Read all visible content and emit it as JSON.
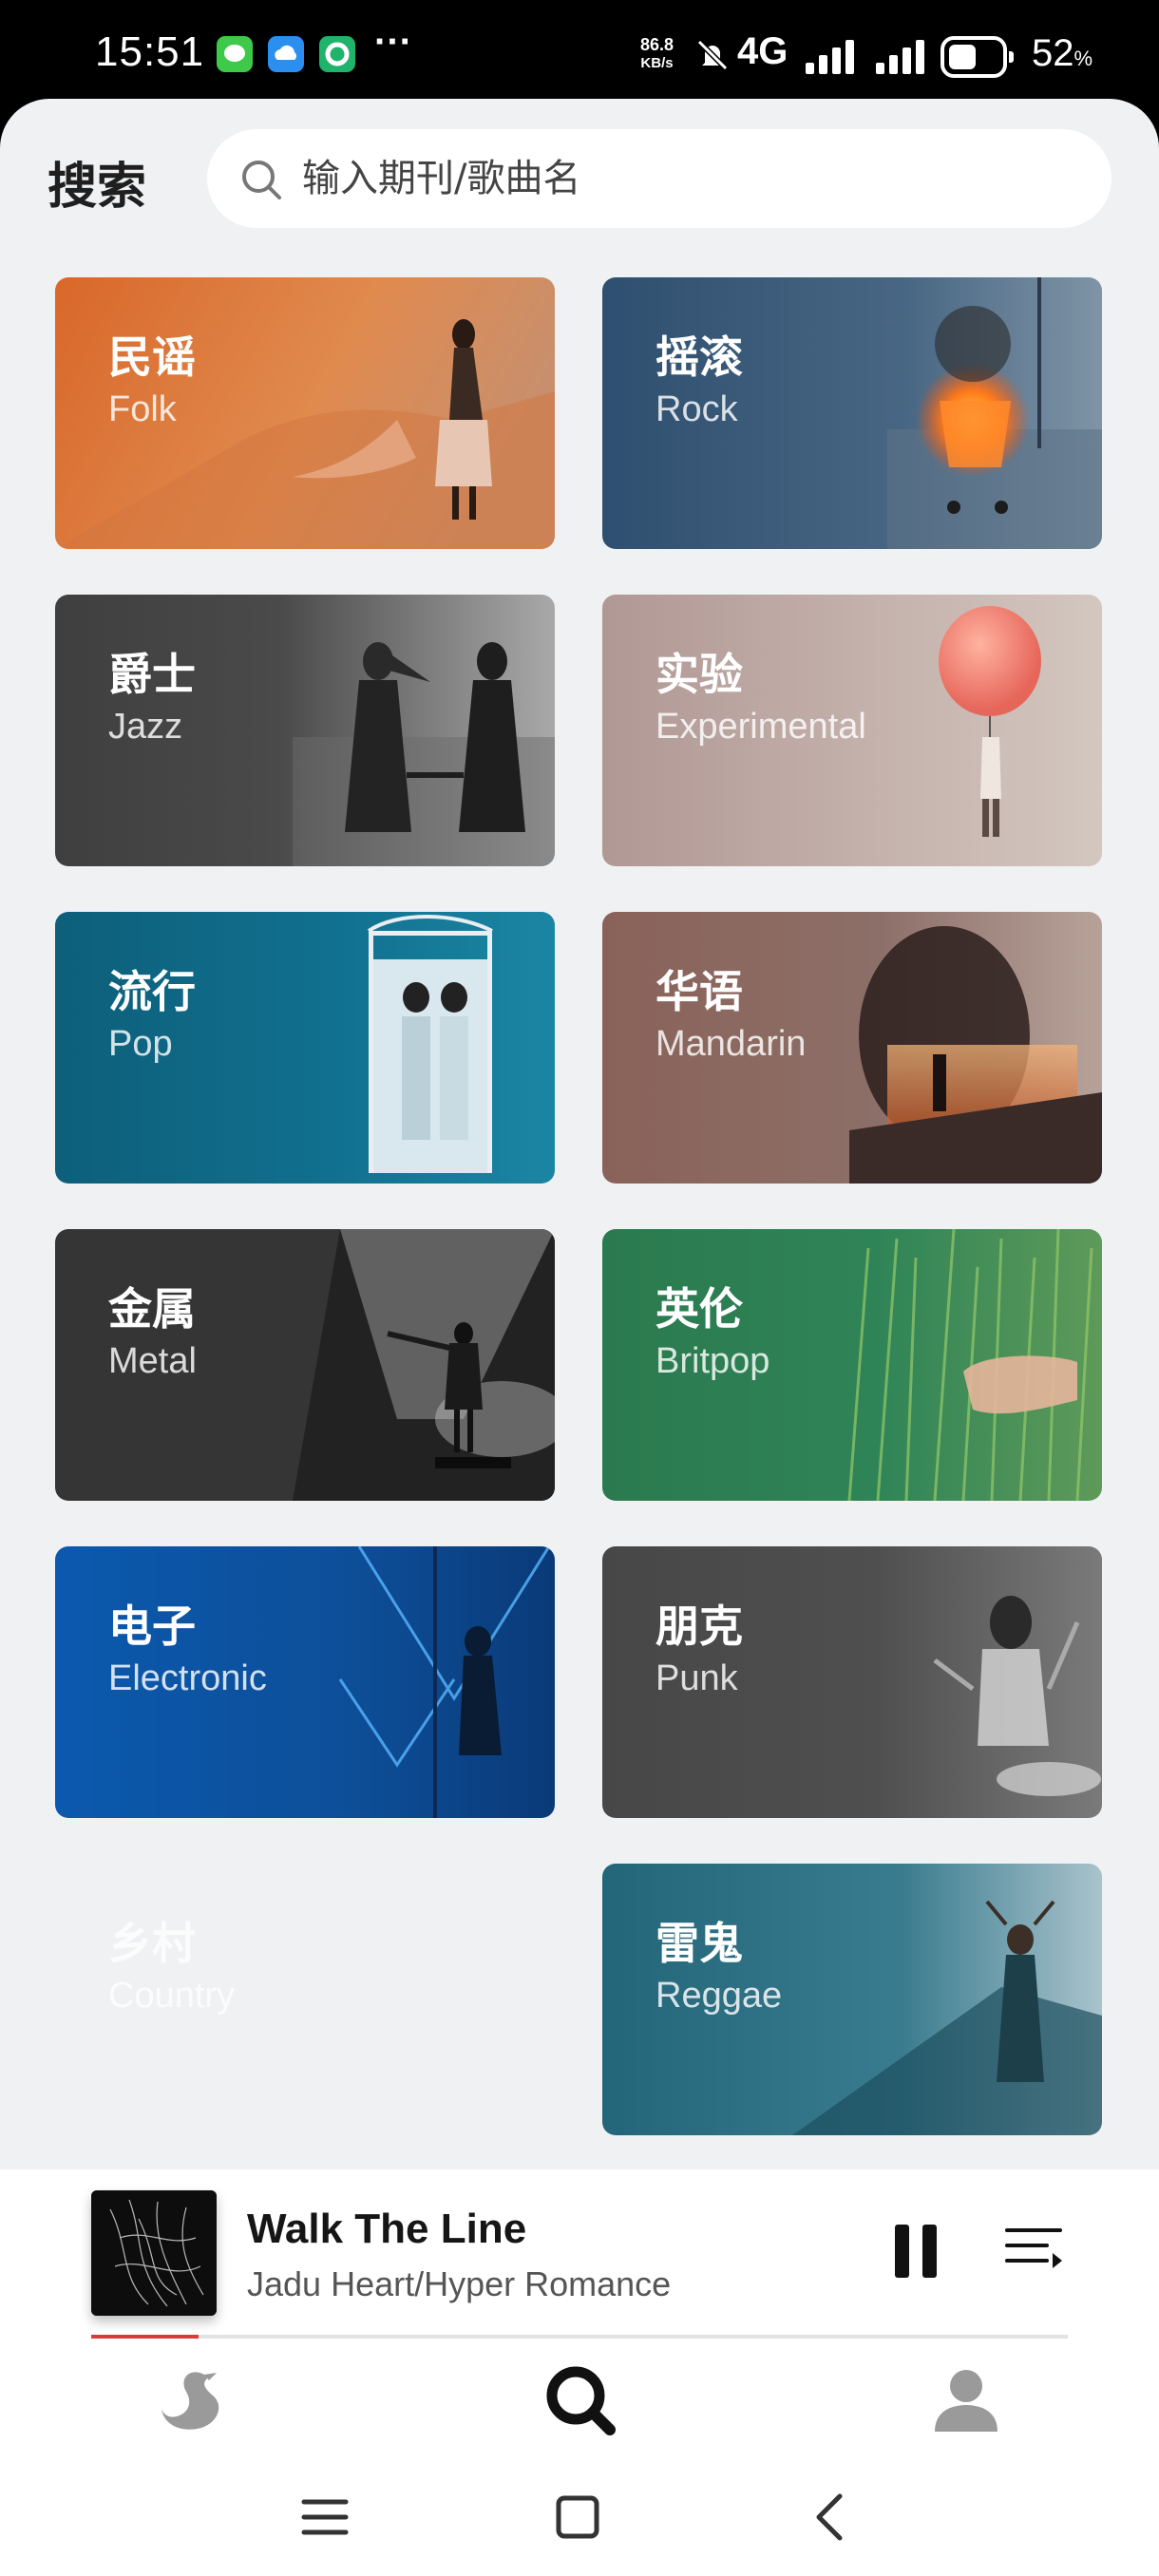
{
  "status_bar": {
    "time": "15:51",
    "more": "···",
    "net_speed_value": "86.8",
    "net_speed_unit": "KB/s",
    "network": "4G",
    "battery_value": "52",
    "battery_unit": "%"
  },
  "search": {
    "label": "搜索",
    "placeholder": "输入期刊/歌曲名"
  },
  "genres": [
    {
      "zh": "民谣",
      "en": "Folk",
      "color": "#d97a3a"
    },
    {
      "zh": "摇滚",
      "en": "Rock",
      "color": "#3a5775"
    },
    {
      "zh": "爵士",
      "en": "Jazz",
      "color": "#4b4b4b"
    },
    {
      "zh": "实验",
      "en": "Experimental",
      "color": "#b8a4a0"
    },
    {
      "zh": "流行",
      "en": "Pop",
      "color": "#116a86"
    },
    {
      "zh": "华语",
      "en": "Mandarin",
      "color": "#8a6a62"
    },
    {
      "zh": "金属",
      "en": "Metal",
      "color": "#3b3b3b"
    },
    {
      "zh": "英伦",
      "en": "Britpop",
      "color": "#2d7f55"
    },
    {
      "zh": "电子",
      "en": "Electronic",
      "color": "#0d5fb0"
    },
    {
      "zh": "朋克",
      "en": "Punk",
      "color": "#4e4e4e"
    },
    {
      "zh": "乡村",
      "en": "Country",
      "color": "#eff1f3"
    },
    {
      "zh": "雷鬼",
      "en": "Reggae",
      "color": "#2b6c80"
    }
  ],
  "player": {
    "title": "Walk The Line",
    "artist": "Jadu Heart/Hyper Romance",
    "progress": 0.11
  },
  "nav": {
    "items": [
      "home",
      "search",
      "profile"
    ],
    "active": "search"
  }
}
